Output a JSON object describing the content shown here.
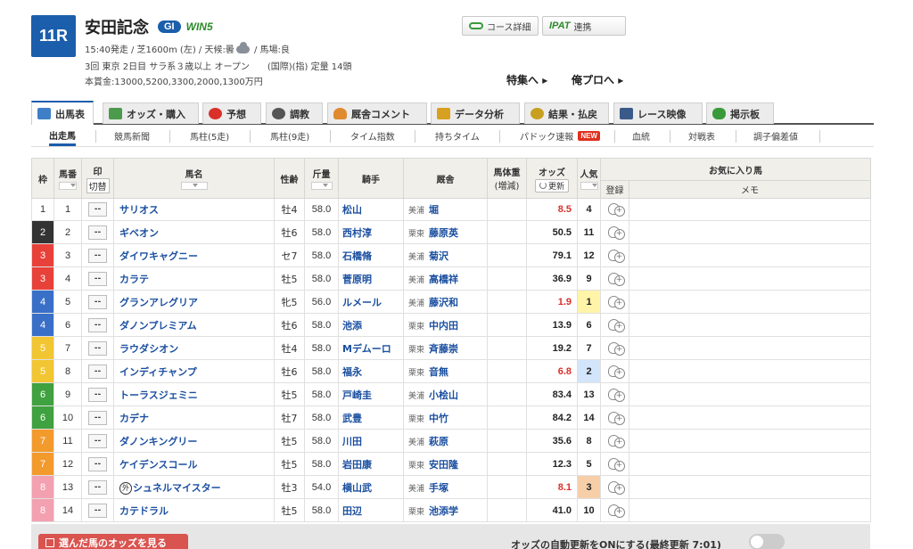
{
  "race": {
    "number": "11R",
    "name": "安田記念",
    "grade": "GI",
    "win5": "WIN5",
    "line1": "15:40発走 / 芝1600m (左) / 天候:曇",
    "line1_tail": " / 馬場:良",
    "line2": "3回 東京 2日目 サラ系３歳以上 オープン　　(国際)(指) 定量 14頭",
    "line3": "本賞金:13000,5200,3300,2000,1300万円",
    "weather_icon": "cloud-icon"
  },
  "header_buttons": {
    "course": "コース詳細",
    "ipat_logo": "IPAT",
    "ipat": "連携",
    "tokushu": "特集へ",
    "orepro": "俺プロへ"
  },
  "main_tabs": [
    {
      "label": "出馬表",
      "icon": "table-icon",
      "color": "#3f7fc8"
    },
    {
      "label": "オッズ・購入",
      "icon": "odds-icon",
      "color": "#4c9a4c"
    },
    {
      "label": "予想",
      "icon": "target-icon",
      "color": "#d9302a"
    },
    {
      "label": "調教",
      "icon": "stopwatch-icon",
      "color": "#555555"
    },
    {
      "label": "厩舎コメント",
      "icon": "person-icon",
      "color": "#e08a30"
    },
    {
      "label": "データ分析",
      "icon": "bar-chart-icon",
      "color": "#d8a020"
    },
    {
      "label": "結果・払戻",
      "icon": "coins-icon",
      "color": "#c8a020"
    },
    {
      "label": "レース映像",
      "icon": "video-icon",
      "color": "#3a5a8a"
    },
    {
      "label": "掲示板",
      "icon": "chat-icon",
      "color": "#3a9a3a"
    }
  ],
  "sub_tabs": [
    "出走馬",
    "競馬新聞",
    "馬柱(5走)",
    "馬柱(9走)",
    "タイム指数",
    "持ちタイム",
    "パドック速報",
    "血統",
    "対戦表",
    "調子偏差値"
  ],
  "new_badge": "NEW",
  "headers": {
    "waku": "枠",
    "umaban": "馬番",
    "mark": "印",
    "kiri": "切替",
    "name": "馬名",
    "sexage": "性齢",
    "kin": "斤量",
    "jockey": "騎手",
    "trainer": "厩舎",
    "weight": "馬体重",
    "weight_sub": "(増減)",
    "odds": "オッズ",
    "odds_update": "更新",
    "ninki": "人気",
    "fav": "お気に入り馬",
    "reg": "登録",
    "memo": "メモ"
  },
  "waku_colors": {
    "1": [
      "#ffffff",
      "#333333"
    ],
    "2": [
      "#333333",
      "#ffffff"
    ],
    "3": [
      "#e8413a",
      "#ffffff"
    ],
    "4": [
      "#3a6fc8",
      "#ffffff"
    ],
    "5": [
      "#f2c532",
      "#ffffff"
    ],
    "6": [
      "#3fa13f",
      "#ffffff"
    ],
    "7": [
      "#f39a2d",
      "#ffffff"
    ],
    "8": [
      "#f3a0b0",
      "#ffffff"
    ]
  },
  "mark_placeholder": "--",
  "horses": [
    {
      "waku": "1",
      "umaban": "1",
      "name": "サリオス",
      "sexage": "牡4",
      "kin": "58.0",
      "jockey": "松山",
      "region": "美浦",
      "trainer": "堀",
      "odds": "8.5",
      "ninki": "4"
    },
    {
      "waku": "2",
      "umaban": "2",
      "name": "ギベオン",
      "sexage": "牡6",
      "kin": "58.0",
      "jockey": "西村淳",
      "region": "栗東",
      "trainer": "藤原英",
      "odds": "50.5",
      "ninki": "11"
    },
    {
      "waku": "3",
      "umaban": "3",
      "name": "ダイワキャグニー",
      "sexage": "セ7",
      "kin": "58.0",
      "jockey": "石橋脩",
      "region": "美浦",
      "trainer": "菊沢",
      "odds": "79.1",
      "ninki": "12"
    },
    {
      "waku": "3",
      "umaban": "4",
      "name": "カラテ",
      "sexage": "牡5",
      "kin": "58.0",
      "jockey": "菅原明",
      "region": "美浦",
      "trainer": "高橋祥",
      "odds": "36.9",
      "ninki": "9"
    },
    {
      "waku": "4",
      "umaban": "5",
      "name": "グランアレグリア",
      "sexage": "牝5",
      "kin": "56.0",
      "jockey": "ルメール",
      "region": "美浦",
      "trainer": "藤沢和",
      "odds": "1.9",
      "ninki": "1"
    },
    {
      "waku": "4",
      "umaban": "6",
      "name": "ダノンプレミアム",
      "sexage": "牡6",
      "kin": "58.0",
      "jockey": "池添",
      "region": "栗東",
      "trainer": "中内田",
      "odds": "13.9",
      "ninki": "6"
    },
    {
      "waku": "5",
      "umaban": "7",
      "name": "ラウダシオン",
      "sexage": "牡4",
      "kin": "58.0",
      "jockey": "Mデムーロ",
      "region": "栗東",
      "trainer": "斉藤崇",
      "odds": "19.2",
      "ninki": "7"
    },
    {
      "waku": "5",
      "umaban": "8",
      "name": "インディチャンプ",
      "sexage": "牡6",
      "kin": "58.0",
      "jockey": "福永",
      "region": "栗東",
      "trainer": "音無",
      "odds": "6.8",
      "ninki": "2"
    },
    {
      "waku": "6",
      "umaban": "9",
      "name": "トーラスジェミニ",
      "sexage": "牡5",
      "kin": "58.0",
      "jockey": "戸崎圭",
      "region": "美浦",
      "trainer": "小桧山",
      "odds": "83.4",
      "ninki": "13"
    },
    {
      "waku": "6",
      "umaban": "10",
      "name": "カデナ",
      "sexage": "牡7",
      "kin": "58.0",
      "jockey": "武豊",
      "region": "栗東",
      "trainer": "中竹",
      "odds": "84.2",
      "ninki": "14"
    },
    {
      "waku": "7",
      "umaban": "11",
      "name": "ダノンキングリー",
      "sexage": "牡5",
      "kin": "58.0",
      "jockey": "川田",
      "region": "美浦",
      "trainer": "萩原",
      "odds": "35.6",
      "ninki": "8"
    },
    {
      "waku": "7",
      "umaban": "12",
      "name": "ケイデンスコール",
      "sexage": "牡5",
      "kin": "58.0",
      "jockey": "岩田康",
      "region": "栗東",
      "trainer": "安田隆",
      "odds": "12.3",
      "ninki": "5"
    },
    {
      "waku": "8",
      "umaban": "13",
      "name": "シュネルマイスター",
      "prefix": "外",
      "sexage": "牡3",
      "kin": "54.0",
      "jockey": "横山武",
      "region": "美浦",
      "trainer": "手塚",
      "odds": "8.1",
      "ninki": "3"
    },
    {
      "waku": "8",
      "umaban": "14",
      "name": "カテドラル",
      "sexage": "牡5",
      "kin": "58.0",
      "jockey": "田辺",
      "region": "栗東",
      "trainer": "池添学",
      "odds": "41.0",
      "ninki": "10"
    }
  ],
  "footer": {
    "odds_button": "選んだ馬のオッズを見る",
    "auto_update": "オッズの自動更新をONにする(最終更新 7:01)"
  }
}
